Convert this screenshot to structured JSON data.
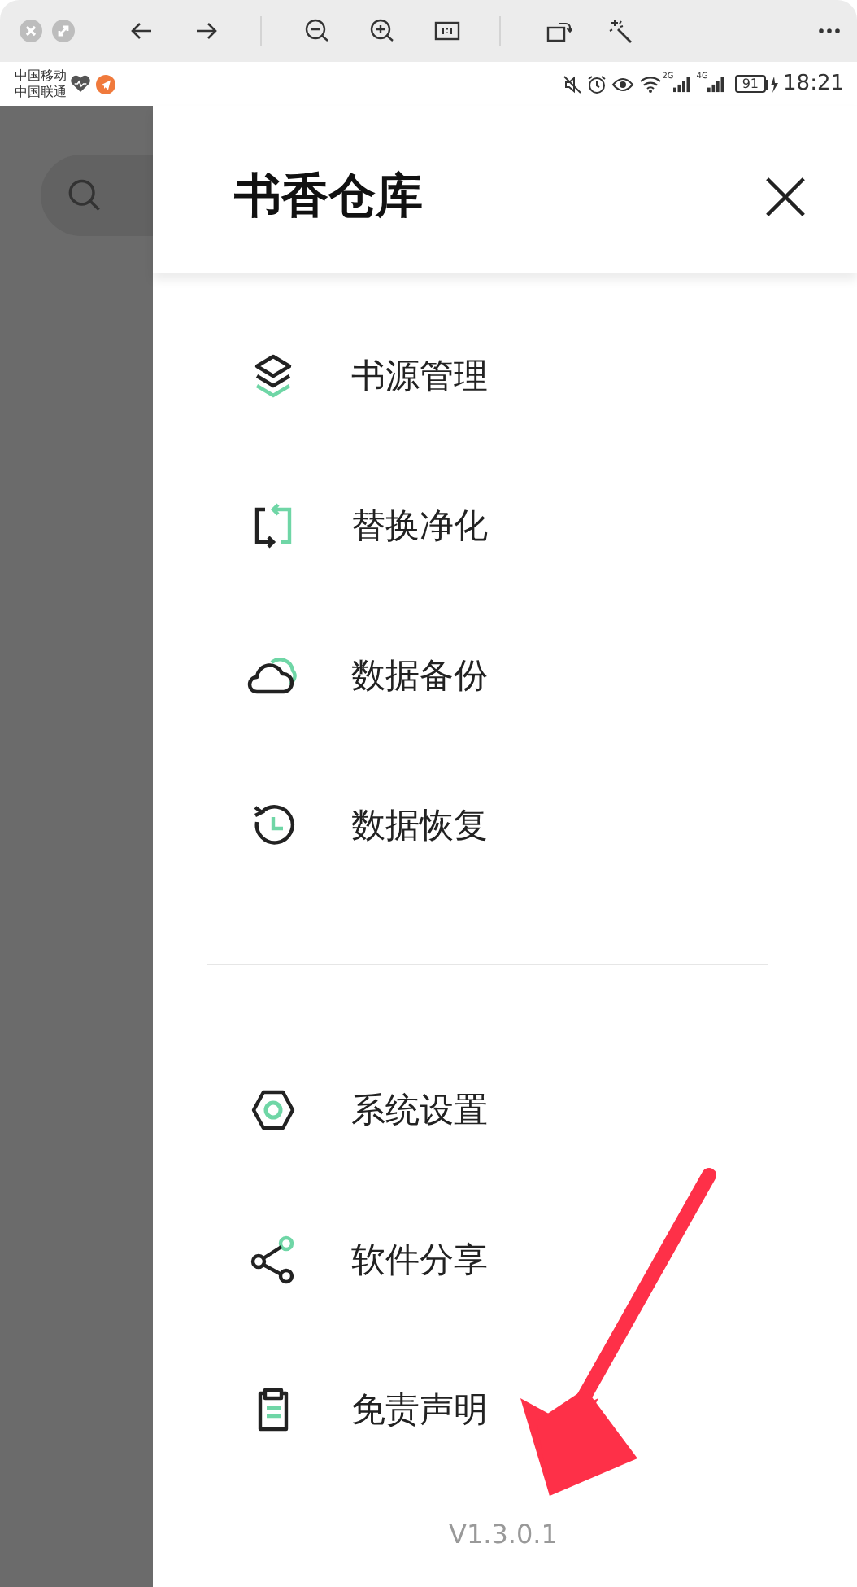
{
  "status_bar": {
    "carriers": [
      "中国移动",
      "中国联通"
    ],
    "network_2": "2G",
    "network_4": "4G",
    "battery": "91",
    "time": "18:21"
  },
  "drawer": {
    "title": "书香仓库",
    "groups": [
      {
        "items": [
          {
            "label": "书源管理"
          },
          {
            "label": "替换净化"
          },
          {
            "label": "数据备份"
          },
          {
            "label": "数据恢复"
          }
        ]
      },
      {
        "items": [
          {
            "label": "系统设置"
          },
          {
            "label": "软件分享"
          },
          {
            "label": "免责声明"
          }
        ]
      }
    ],
    "version": "V1.3.0.1"
  }
}
